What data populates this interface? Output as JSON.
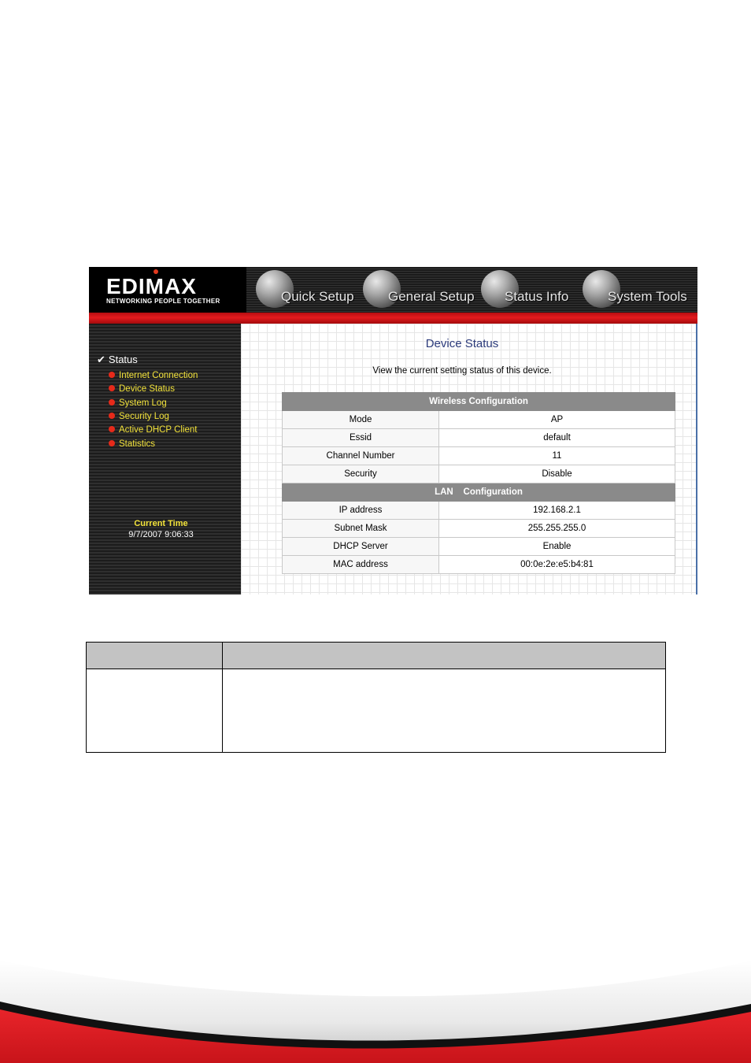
{
  "brand": {
    "logo": "EDIMAX",
    "tagline": "NETWORKING PEOPLE TOGETHER"
  },
  "nav": [
    {
      "label": "Quick Setup",
      "icon": "quick-setup-globe-icon"
    },
    {
      "label": "General Setup",
      "icon": "general-setup-globe-icon"
    },
    {
      "label": "Status Info",
      "icon": "status-info-globe-icon"
    },
    {
      "label": "System Tools",
      "icon": "system-tools-globe-icon"
    }
  ],
  "sidebar": {
    "section": "Status",
    "items": [
      "Internet Connection",
      "Device Status",
      "System Log",
      "Security Log",
      "Active DHCP Client",
      "Statistics"
    ],
    "current_time_label": "Current Time",
    "current_time_value": "9/7/2007 9:06:33"
  },
  "main": {
    "title": "Device Status",
    "description": "View the current setting status of this device.",
    "wireless": {
      "header": "Wireless Configuration",
      "rows": [
        {
          "label": "Mode",
          "value": "AP"
        },
        {
          "label": "Essid",
          "value": "default"
        },
        {
          "label": "Channel Number",
          "value": "11"
        },
        {
          "label": "Security",
          "value": "Disable"
        }
      ]
    },
    "lan": {
      "header": "LAN    Configuration",
      "rows": [
        {
          "label": "IP address",
          "value": "192.168.2.1"
        },
        {
          "label": "Subnet Mask",
          "value": "255.255.255.0"
        },
        {
          "label": "DHCP Server",
          "value": "Enable"
        },
        {
          "label": "MAC address",
          "value": "00:0e:2e:e5:b4:81"
        }
      ]
    }
  },
  "colors": {
    "brand_red": "#e31b1e",
    "menu_yellow": "#f2e23a",
    "section_gray": "#8a8a8a"
  }
}
